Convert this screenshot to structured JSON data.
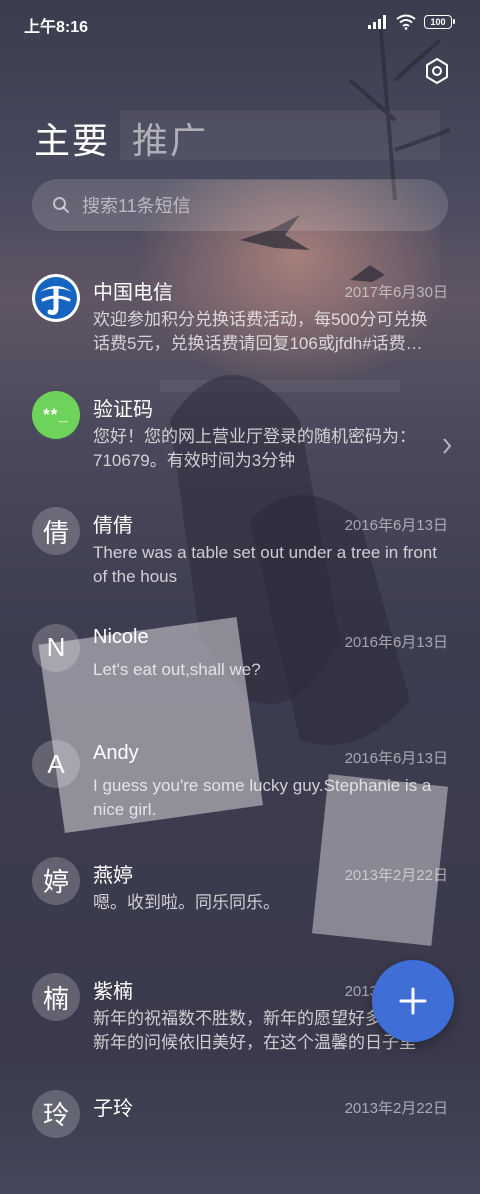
{
  "status_bar": {
    "time": "上午8:16",
    "battery": "100"
  },
  "tabs": [
    {
      "label": "主要",
      "active": true
    },
    {
      "label": "推广",
      "active": false
    }
  ],
  "search": {
    "placeholder": "搜索11条短信"
  },
  "conversations": [
    {
      "avatar": "",
      "avatar_icon": "china-telecom-logo-icon",
      "name": "中国电信",
      "date": "2017年6月30日",
      "preview": "欢迎参加积分兑换话费活动，每500分可兑换话费5元，兑换话费请回复106或jfdh#话费…"
    },
    {
      "avatar": "**_",
      "name": "验证码",
      "date": "",
      "preview": "您好！您的网上营业厅登录的随机密码为：710679。有效时间为3分钟"
    },
    {
      "avatar": "倩",
      "name": "倩倩",
      "date": "2016年6月13日",
      "preview": "There was a table set out under a tree in front of the hous"
    },
    {
      "avatar": "N",
      "name": "Nicole",
      "date": "2016年6月13日",
      "preview": "Let's eat out,shall we?"
    },
    {
      "avatar": "A",
      "name": "Andy",
      "date": "2016年6月13日",
      "preview": "I guess you're some lucky guy.Stephanie is a nice girl."
    },
    {
      "avatar": "婷",
      "name": "燕婷",
      "date": "2013年2月22日",
      "preview": "嗯。收到啦。同乐同乐。"
    },
    {
      "avatar": "楠",
      "name": "紫楠",
      "date": "2013年2月22日",
      "preview": "新年的祝福数不胜数，新年的愿望好多好多，新年的问候依旧美好，在这个温馨的日子里"
    },
    {
      "avatar": "玲",
      "name": "子玲",
      "date": "2013年2月22日",
      "preview": ""
    }
  ],
  "fab": {
    "icon": "plus-icon"
  },
  "colors": {
    "accent": "#3f6fd6",
    "code_avatar": "#6dd35a",
    "telecom_blue": "#1565c0"
  }
}
